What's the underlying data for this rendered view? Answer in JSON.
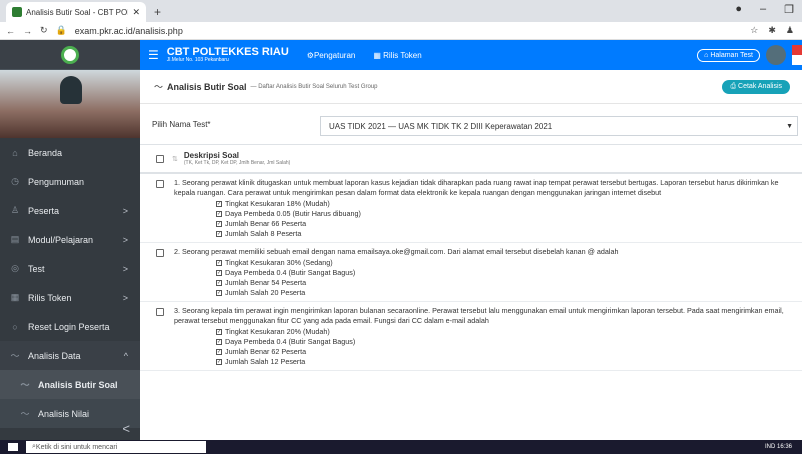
{
  "browser": {
    "tab_title": "Analisis Butir Soal - CBT POLTEKES",
    "new_tab": "+",
    "url": "exam.pkr.ac.id/analisis.php"
  },
  "sidebar": {
    "items": [
      {
        "label": "Beranda",
        "icon": "home-icon"
      },
      {
        "label": "Pengumuman",
        "icon": "bell-icon"
      },
      {
        "label": "Peserta",
        "icon": "users-icon",
        "caret": ">"
      },
      {
        "label": "Modul/Pelajaran",
        "icon": "book-icon",
        "caret": ">"
      },
      {
        "label": "Test",
        "icon": "test-icon",
        "caret": ">"
      },
      {
        "label": "Rilis Token",
        "icon": "token-icon",
        "caret": ">"
      },
      {
        "label": "Reset Login Peserta",
        "icon": "reset-icon"
      },
      {
        "label": "Analisis Data",
        "icon": "chart-icon",
        "caret": "^"
      },
      {
        "label": "Analisis Butir Soal",
        "icon": "chart-icon"
      },
      {
        "label": "Analisis Nilai",
        "icon": "chart-icon"
      }
    ],
    "collapse": "<"
  },
  "topnav": {
    "brand": "CBT POLTEKKES RIAU",
    "address": "Jl.Melur No. 103 Pekanbaru",
    "pengaturan": "Pengaturan",
    "rilis": "Rilis Token",
    "home_button": "Halaman Test"
  },
  "page": {
    "title": "Analisis Butir Soal",
    "subtitle": "Daftar Analisis Butir Soal Seluruh Test Group",
    "print_button": "Cetak Analisis"
  },
  "filter": {
    "label": "Pilih Nama Test*",
    "selected": "UAS TIDK 2021 — UAS MK TIDK TK 2 DIII Keperawatan 2021"
  },
  "table": {
    "header": "Deskripsi Soal",
    "header_sub": "(TK, Ket Tk, DP, Ket DP, Jmlh Benar, Jml Salah)"
  },
  "questions": [
    {
      "text": "1. Seorang perawat klinik ditugaskan untuk membuat laporan kasus kejadian tidak diharapkan pada ruang rawat inap tempat perawat tersebut bertugas. Laporan tersebut harus dikirimkan ke kepala ruangan. Cara perawat untuk mengirimkan pesan dalam format data elektronik ke kepala ruangan dengan menggunakan jaringan internet disebut",
      "tk": "Tingkat Kesukaran 18% (Mudah)",
      "dp": "Daya Pembeda 0.05 (Butir Harus dibuang)",
      "benar": "Jumlah Benar 66 Peserta",
      "salah": "Jumlah Salah 8 Peserta"
    },
    {
      "text": "2. Seorang perawat memiliki sebuah email dengan nama emailsaya.oke@gmail.com. Dari alamat email tersebut disebelah kanan @ adalah",
      "tk": "Tingkat Kesukaran 30% (Sedang)",
      "dp": "Daya Pembeda 0.4 (Butir Sangat Bagus)",
      "benar": "Jumlah Benar 54 Peserta",
      "salah": "Jumlah Salah 20 Peserta"
    },
    {
      "text": "3. Seorang kepala tim perawat ingin mengirimkan laporan bulanan secaraonline. Perawat tersebut lalu menggunakan email untuk mengirimkan laporan tersebut. Pada saat mengirimkan email, perawat tersebut menggunakan fitur CC yang ada pada email. Fungsi dari CC dalam e-mail adalah",
      "tk": "Tingkat Kesukaran 20% (Mudah)",
      "dp": "Daya Pembeda 0.4 (Butir Sangat Bagus)",
      "benar": "Jumlah Benar 62 Peserta",
      "salah": "Jumlah Salah 12 Peserta"
    }
  ],
  "taskbar": {
    "search": "Ketik di sini untuk mencari",
    "tray": "IND",
    "time": "16:36"
  }
}
